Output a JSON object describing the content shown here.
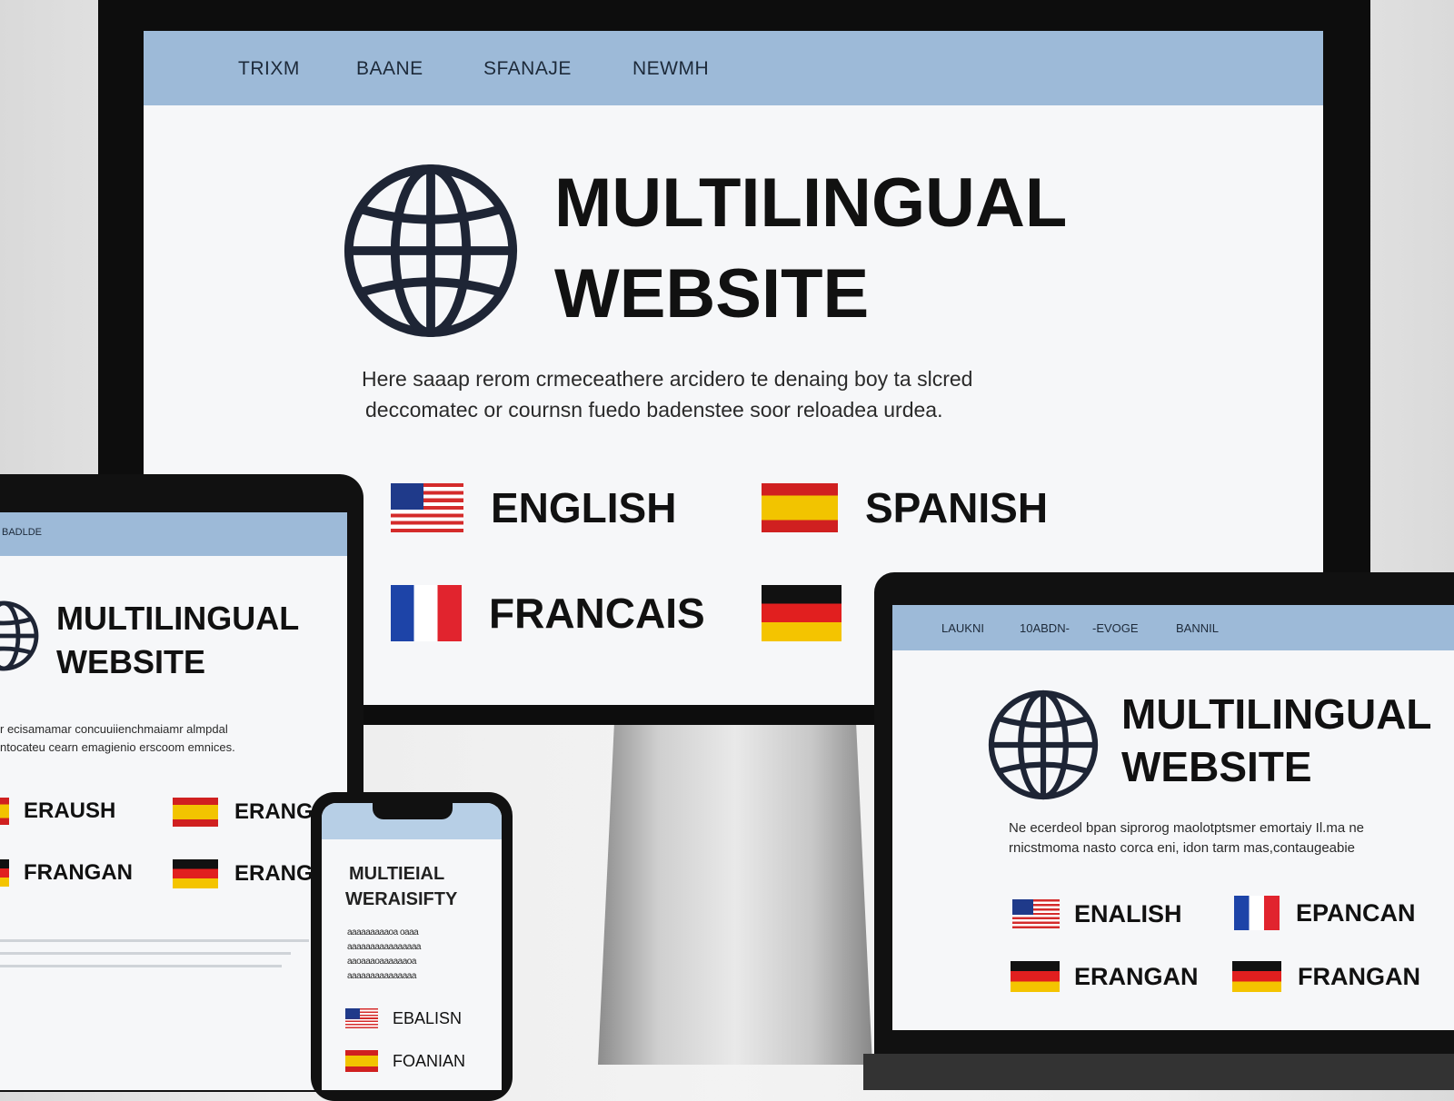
{
  "monitor": {
    "nav": [
      "TRIXM",
      "BAANE",
      "SFANAJE",
      "NEWMH"
    ],
    "title_line1": "MULTILINGUAL",
    "title_line2": "WEBSITE",
    "paragraph_line1": "Here saaap rerom crmeceathere arcidero te denaing boy ta slcred",
    "paragraph_line2": "deccomatec or cournsn fuedo badenstee soor reloadea urdea.",
    "languages": [
      {
        "name": "ENGLISH",
        "flag": "us"
      },
      {
        "name": "SPANISH",
        "flag": "es"
      },
      {
        "name": "FRANCAIS",
        "flag": "fr"
      },
      {
        "name": "",
        "flag": "de"
      }
    ]
  },
  "tablet": {
    "nav": "BADLDE",
    "title_line1": "MULTILINGUAL",
    "title_line2": "WEBSITE",
    "paragraph_line1": "r ecisamamar concuuiienchmaiamr almpdal",
    "paragraph_line2": "ntocateu cearn emagienio erscoom emnices.",
    "languages": [
      {
        "name": "ERAUSH",
        "flag": "es"
      },
      {
        "name": "ERANG",
        "flag": "es"
      },
      {
        "name": "FRANGAN",
        "flag": "de"
      },
      {
        "name": "ERANG",
        "flag": "de"
      }
    ]
  },
  "laptop": {
    "nav": [
      "LAUKNI",
      "10ABDN-",
      "-EVOGE",
      "BANNIL"
    ],
    "title_line1": "MULTILINGUAL",
    "title_line2": "WEBSITE",
    "paragraph_line1": "Ne ecerdeol bpan siprorog maolotptsmer emortaiy Il.ma ne",
    "paragraph_line2": "rnicstmoma nasto corca eni, idon tarm mas,contaugeabie",
    "languages": [
      {
        "name": "ENALISH",
        "flag": "us"
      },
      {
        "name": "EPANCAN",
        "flag": "fr"
      },
      {
        "name": "ERANGAN",
        "flag": "de"
      },
      {
        "name": "FRANGAN",
        "flag": "de"
      }
    ]
  },
  "phone": {
    "title_line1": "MULTIEIAL",
    "title_line2": "WERAISIFTY",
    "paragraph_lines": [
      "aaaaaaaaaoa oaaa",
      "aaaaaaaaaaaaaaaa",
      "aaoaaaoaaaaaaoa",
      "aaaaaaaaaaaaaaa"
    ],
    "languages": [
      {
        "name": "EBALISN",
        "flag": "us"
      },
      {
        "name": "FOANIAN",
        "flag": "es"
      }
    ]
  },
  "colors": {
    "nav_bar": "#9dbad8",
    "device_frame": "#0d0d0d",
    "screen_bg": "#f6f7f9",
    "text": "#111111"
  }
}
